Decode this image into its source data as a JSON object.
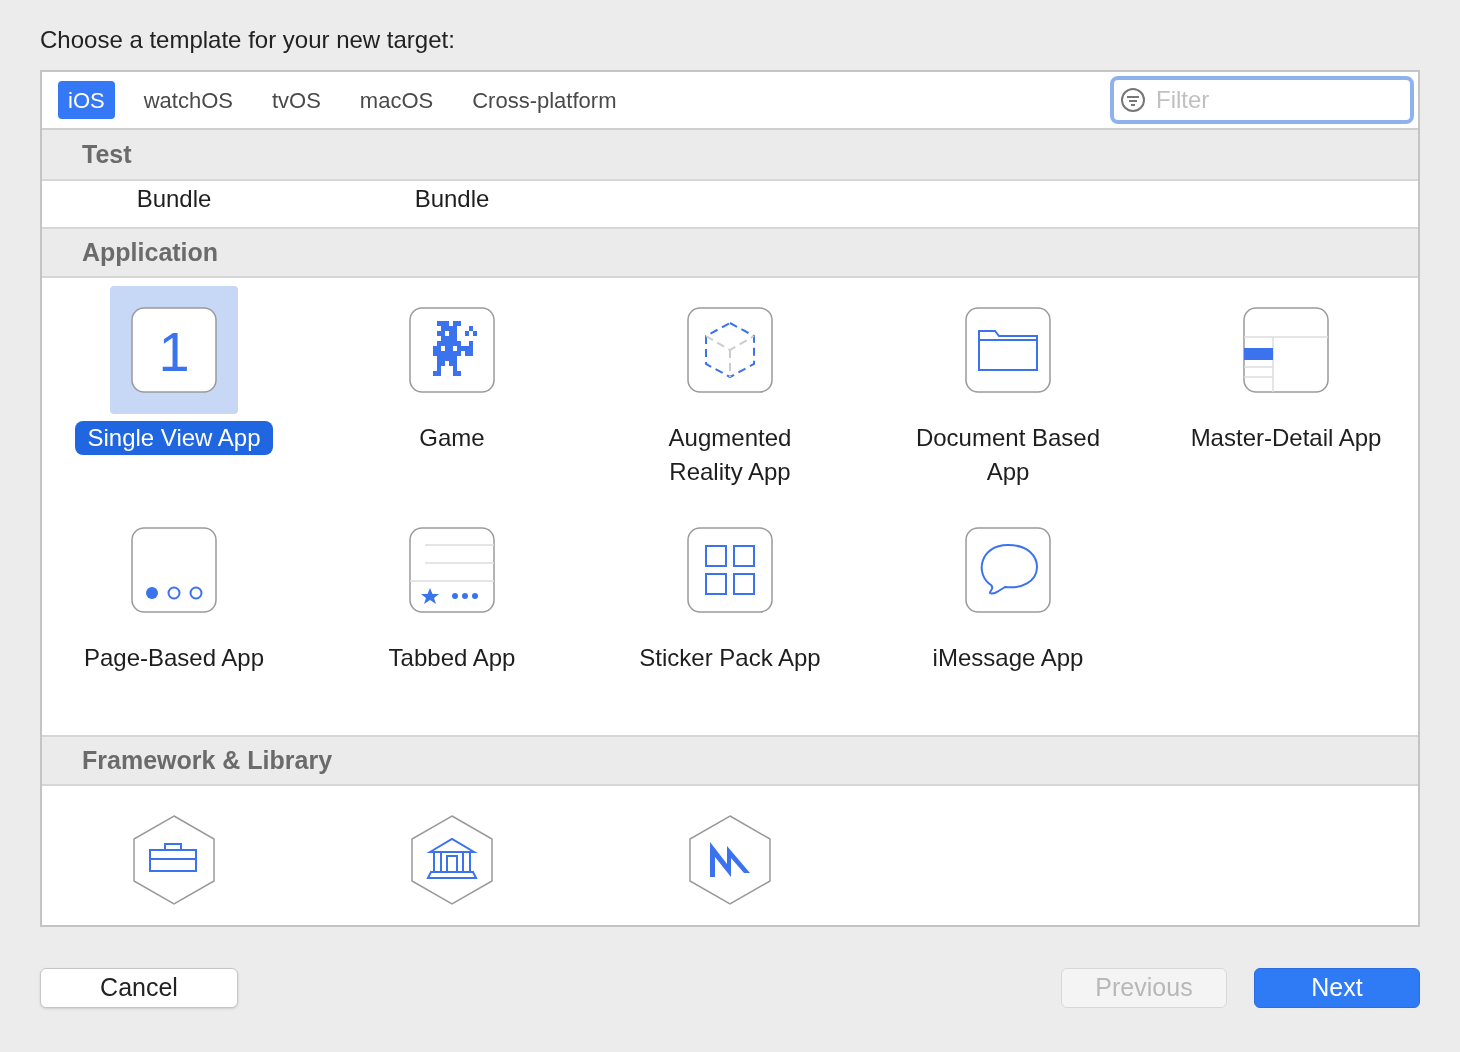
{
  "prompt": "Choose a template for your new target:",
  "tabs": [
    {
      "label": "iOS",
      "selected": true
    },
    {
      "label": "watchOS",
      "selected": false
    },
    {
      "label": "tvOS",
      "selected": false
    },
    {
      "label": "macOS",
      "selected": false
    },
    {
      "label": "Cross-platform",
      "selected": false
    }
  ],
  "filter": {
    "placeholder": "Filter"
  },
  "sections": [
    {
      "title": "Test",
      "templates": [
        {
          "label": "Bundle",
          "selected": false
        },
        {
          "label": "Bundle",
          "selected": false
        }
      ]
    },
    {
      "title": "Application",
      "templates": [
        {
          "label": "Single View App",
          "selected": true,
          "icon_text": "1"
        },
        {
          "label": "Game",
          "selected": false
        },
        {
          "label": "Augmented Reality App",
          "selected": false
        },
        {
          "label": "Document Based App",
          "selected": false
        },
        {
          "label": "Master-Detail App",
          "selected": false
        },
        {
          "label": "Page-Based App",
          "selected": false
        },
        {
          "label": "Tabbed App",
          "selected": false
        },
        {
          "label": "Sticker Pack App",
          "selected": false
        },
        {
          "label": "iMessage App",
          "selected": false
        }
      ]
    },
    {
      "title": "Framework & Library",
      "templates": [
        {
          "selected": false
        },
        {
          "selected": false
        },
        {
          "selected": false
        }
      ]
    }
  ],
  "buttons": [
    {
      "label": "Cancel",
      "disabled": false,
      "primary": false
    },
    {
      "label": "Previous",
      "disabled": true,
      "primary": false
    },
    {
      "label": "Next",
      "disabled": false,
      "primary": true
    }
  ]
}
